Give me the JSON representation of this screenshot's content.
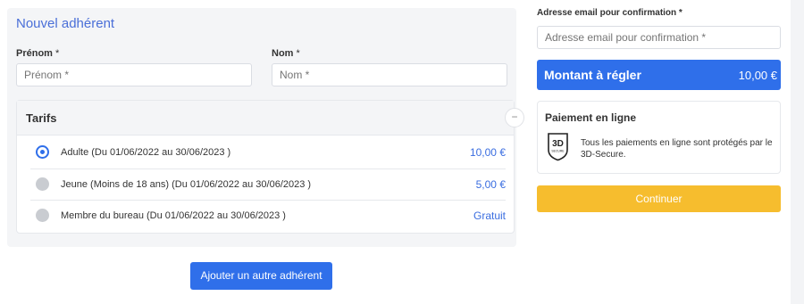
{
  "form": {
    "title": "Nouvel adhérent",
    "prenom_label": "Prénom",
    "prenom_placeholder": "Prénom *",
    "nom_label": "Nom",
    "nom_placeholder": "Nom *",
    "required_mark": "*"
  },
  "tarifs": {
    "title": "Tarifs",
    "collapse_symbol": "−",
    "items": [
      {
        "label": "Adulte (Du 01/06/2022 au 30/06/2023 )",
        "price": "10,00 €",
        "selected": true
      },
      {
        "label": "Jeune (Moins de 18 ans) (Du 01/06/2022 au 30/06/2023 )",
        "price": "5,00 €",
        "selected": false
      },
      {
        "label": "Membre du bureau (Du 01/06/2022 au 30/06/2023 )",
        "price": "Gratuit",
        "selected": false
      }
    ]
  },
  "add_button": "Ajouter un autre adhérent",
  "email": {
    "label": "Adresse email pour confirmation *",
    "placeholder": "Adresse email pour confirmation *"
  },
  "amount": {
    "label": "Montant à régler",
    "value": "10,00 €"
  },
  "payment": {
    "title": "Paiement en ligne",
    "badge_main": "3D",
    "badge_sub": "SECURE",
    "text": "Tous les paiements en ligne sont protégés par le 3D-Secure."
  },
  "continue_button": "Continuer",
  "colors": {
    "primary": "#2f6fea",
    "accent_yellow": "#f6bd2e",
    "card_bg": "#f4f5f7"
  }
}
